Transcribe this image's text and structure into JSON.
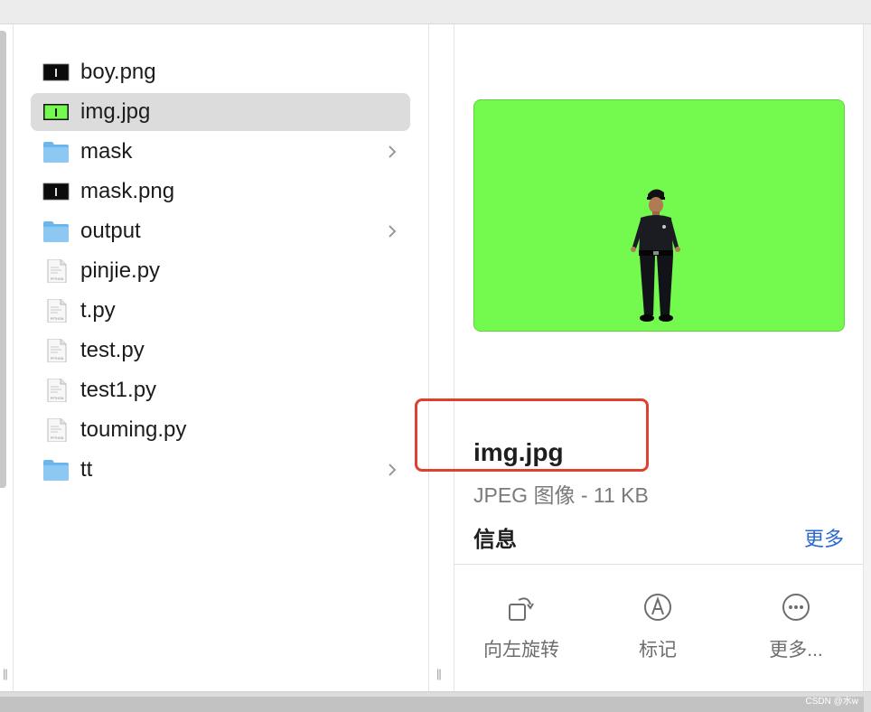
{
  "files": [
    {
      "name": "boy.png",
      "kind": "image-dark",
      "folder": false,
      "selected": false
    },
    {
      "name": "img.jpg",
      "kind": "image-green",
      "folder": false,
      "selected": true
    },
    {
      "name": "mask",
      "kind": "folder",
      "folder": true,
      "selected": false
    },
    {
      "name": "mask.png",
      "kind": "image-dark",
      "folder": false,
      "selected": false
    },
    {
      "name": "output",
      "kind": "folder",
      "folder": true,
      "selected": false
    },
    {
      "name": "pinjie.py",
      "kind": "python",
      "folder": false,
      "selected": false
    },
    {
      "name": "t.py",
      "kind": "python",
      "folder": false,
      "selected": false
    },
    {
      "name": "test.py",
      "kind": "python",
      "folder": false,
      "selected": false
    },
    {
      "name": "test1.py",
      "kind": "python",
      "folder": false,
      "selected": false
    },
    {
      "name": "touming.py",
      "kind": "python",
      "folder": false,
      "selected": false
    },
    {
      "name": "tt",
      "kind": "folder",
      "folder": true,
      "selected": false
    }
  ],
  "preview": {
    "title": "img.jpg",
    "subtitle": "JPEG 图像 - 11 KB",
    "info_heading": "信息",
    "more_link": "更多",
    "image_bg": "#74f94f"
  },
  "actions": [
    {
      "label": "向左旋转",
      "icon": "rotate-left-icon"
    },
    {
      "label": "标记",
      "icon": "markup-icon"
    },
    {
      "label": "更多...",
      "icon": "more-icon"
    }
  ],
  "resize_glyph": "||",
  "icon_text": {
    "python": "PYTHON"
  },
  "watermark": "CSDN @水w",
  "colors": {
    "selection": "#dcdcdc",
    "folder_blue": "#6cb6ec",
    "link_blue": "#2a68d6",
    "highlight_red": "#e0402e"
  }
}
